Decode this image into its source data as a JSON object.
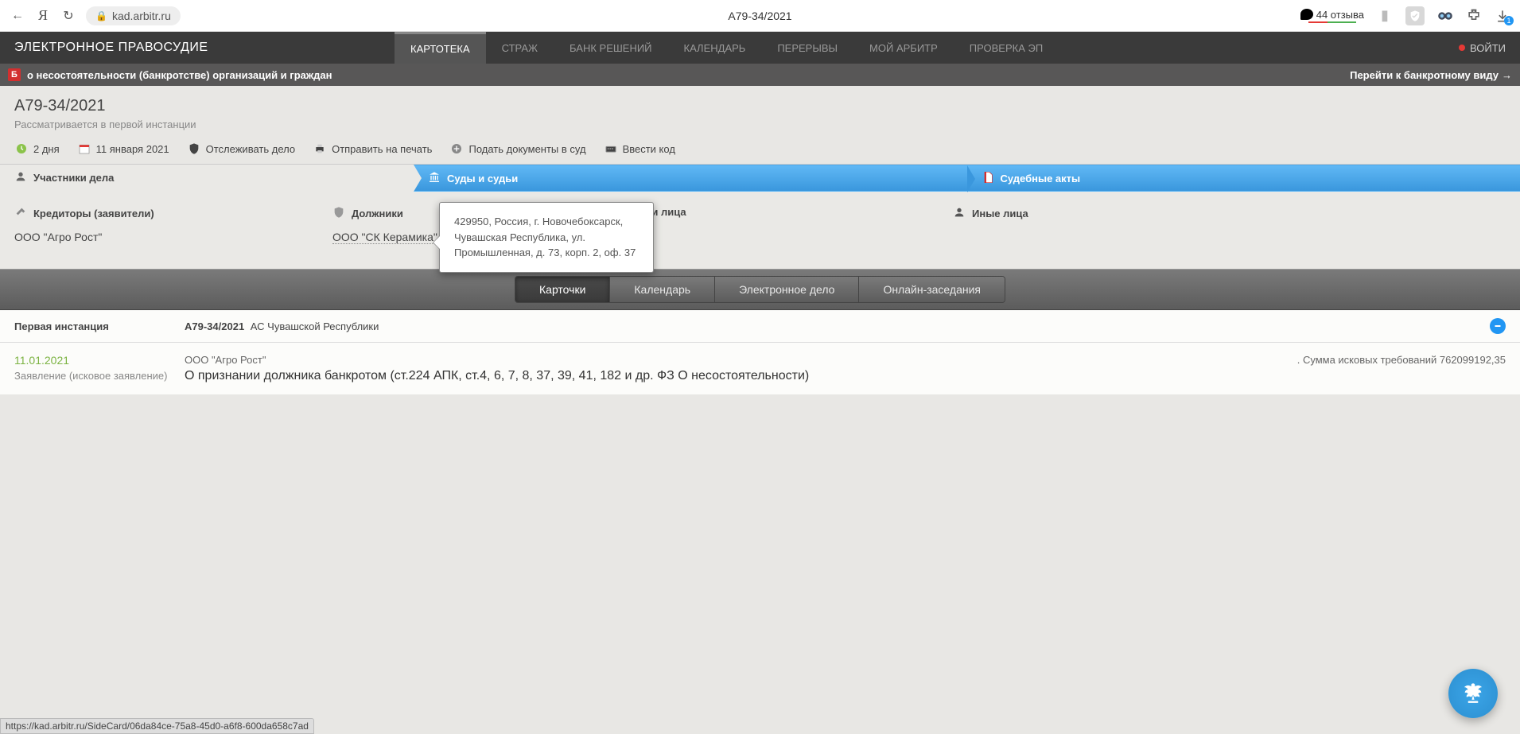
{
  "browser": {
    "url_host": "kad.arbitr.ru",
    "tab_title": "А79-34/2021",
    "reviews": "44 отзыва"
  },
  "topnav": {
    "logo": "ЭЛЕКТРОННОЕ ПРАВОСУДИЕ",
    "items": [
      "КАРТОТЕКА",
      "СТРАЖ",
      "БАНК РЕШЕНИЙ",
      "КАЛЕНДАРЬ",
      "ПЕРЕРЫВЫ",
      "МОЙ АРБИТР",
      "ПРОВЕРКА ЭП"
    ],
    "login": "ВОЙТИ"
  },
  "banner": {
    "icon_letter": "Б",
    "text": "о несостоятельности (банкротстве) организаций и граждан",
    "right_link": "Перейти к банкротному виду"
  },
  "case": {
    "number": "А79-34/2021",
    "status": "Рассматривается в первой инстанции"
  },
  "actions": {
    "duration": "2 дня",
    "date": "11 января 2021",
    "track": "Отслеживать дело",
    "print": "Отправить на печать",
    "submit": "Подать документы в суд",
    "code": "Ввести код"
  },
  "tabs": {
    "participants": "Участники дела",
    "courts": "Суды и судьи",
    "acts": "Судебные акты"
  },
  "parties": {
    "creditors_title": "Кредиторы (заявители)",
    "creditors": "ООО \"Агро Рост\"",
    "debtors_title": "Должники",
    "debtors": "ООО \"СК Керамика\"",
    "third_title": "етьи лица",
    "other_title": "Иные лица"
  },
  "tooltip": {
    "text": "429950, Россия, г. Новочебоксарск, Чувашская Республика, ул. Промышленная, д. 73, корп. 2, оф. 37"
  },
  "subtabs": [
    "Карточки",
    "Календарь",
    "Электронное дело",
    "Онлайн-заседания"
  ],
  "instance": {
    "title": "Первая инстанция",
    "case_no": "А79-34/2021",
    "court": "АС Чувашской Республики"
  },
  "entry": {
    "date": "11.01.2021",
    "type": "Заявление (исковое заявление)",
    "party": "ООО \"Агро Рост\"",
    "subject": "О признании должника банкротом (ст.224 АПК, ст.4, 6, 7, 8, 37, 39, 41, 182 и др. ФЗ О несостоятельности)",
    "sum": ". Сумма исковых требований 762099192,35"
  },
  "status_url": "https://kad.arbitr.ru/SideCard/06da84ce-75a8-45d0-a6f8-600da658c7ad"
}
